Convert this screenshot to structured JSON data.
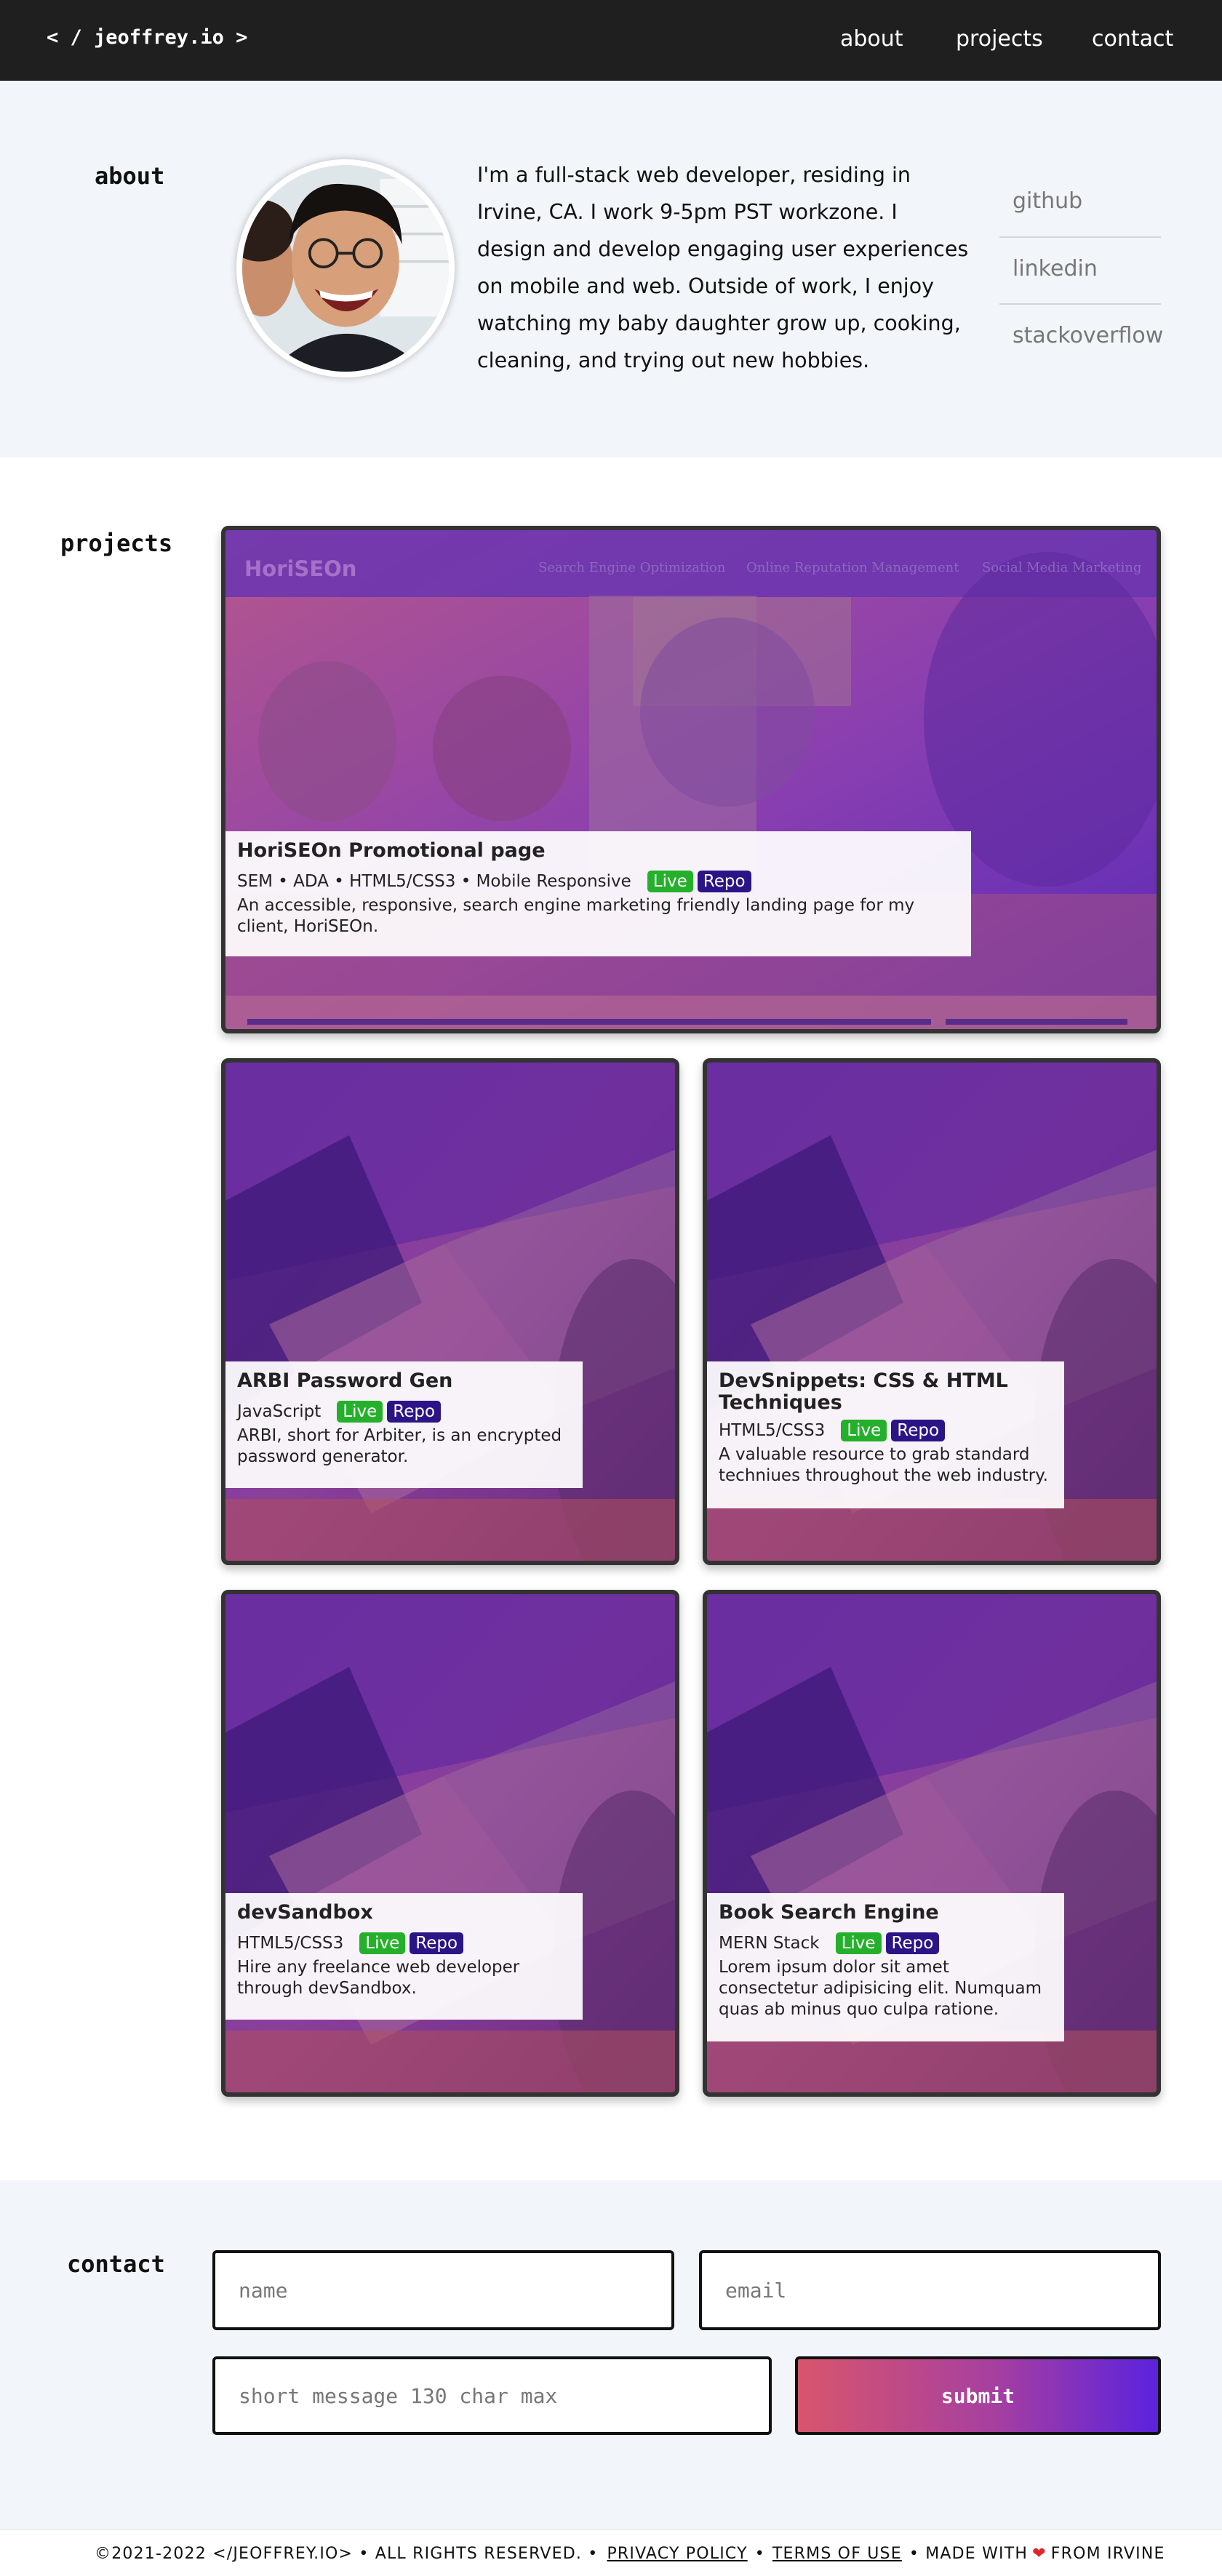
{
  "nav": {
    "logo": "< / jeoffrey.io >",
    "links": [
      "about",
      "projects",
      "contact"
    ]
  },
  "about": {
    "heading": "about",
    "bio": "I'm a full-stack web developer, residing in Irvine, CA. I work 9-5pm PST workzone. I design and develop engaging user experiences on mobile and web. Outside of work, I enjoy watching my baby daughter grow up, cooking, cleaning, and trying out new hobbies.",
    "social": [
      "github",
      "linkedin",
      "stackoverflow"
    ]
  },
  "projects": {
    "heading": "projects",
    "featured_screenshot": {
      "brand": "HoriSEOn",
      "nav": [
        "Search Engine Optimization",
        "Online Reputation Management",
        "Social Media Marketing"
      ]
    },
    "items": [
      {
        "title": "HoriSEOn Promotional page",
        "tech": "SEM • ADA • HTML5/CSS3 • Mobile Responsive",
        "live": "Live",
        "repo": "Repo",
        "description": "An accessible, responsive, search engine marketing friendly landing page for my client, HoriSEOn."
      },
      {
        "title": "ARBI Password Gen",
        "tech": "JavaScript",
        "live": "Live",
        "repo": "Repo",
        "description": "ARBI, short for Arbiter, is an encrypted password generator."
      },
      {
        "title": "DevSnippets: CSS & HTML Techniques",
        "tech": "HTML5/CSS3",
        "live": "Live",
        "repo": "Repo",
        "description": "A valuable resource to grab standard techniues throughout the web industry."
      },
      {
        "title": "devSandbox",
        "tech": "HTML5/CSS3",
        "live": "Live",
        "repo": "Repo",
        "description": "Hire any freelance web developer through devSandbox."
      },
      {
        "title": "Book Search Engine",
        "tech": "MERN Stack",
        "live": "Live",
        "repo": "Repo",
        "description": "Lorem ipsum dolor sit amet consectetur adipisicing elit. Numquam quas ab minus quo culpa ratione."
      }
    ]
  },
  "contact": {
    "heading": "contact",
    "name_placeholder": "name",
    "email_placeholder": "email",
    "message_placeholder": "short message 130 char max",
    "submit_label": "submit"
  },
  "footer": {
    "copyright": "©2021-2022 </JEOFFREY.IO> • ALL RIGHTS RESERVED. •",
    "privacy": "PRIVACY POLICY",
    "sep": "•",
    "terms": "TERMS OF USE",
    "made_with": "• MADE WITH",
    "from": "FROM IRVINE"
  },
  "colors": {
    "nav_bg": "#1f1f1f",
    "section_bg": "#f2f5fa",
    "live_badge": "#25b02b",
    "repo_badge": "#2c1486",
    "submit_start": "#d8556c",
    "submit_end": "#5b22dd"
  }
}
